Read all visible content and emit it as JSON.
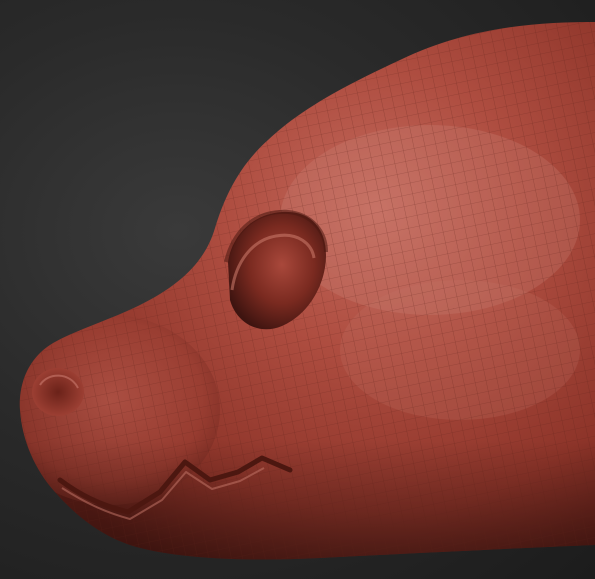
{
  "viewport": {
    "background_color": "#2b2b2b",
    "material_color": "#a8483b",
    "highlight_color": "#c8786e",
    "shadow_color": "#5c1f18",
    "wireframe_color": "#6a2a22",
    "object": "sculpted-creature-head-icon"
  }
}
